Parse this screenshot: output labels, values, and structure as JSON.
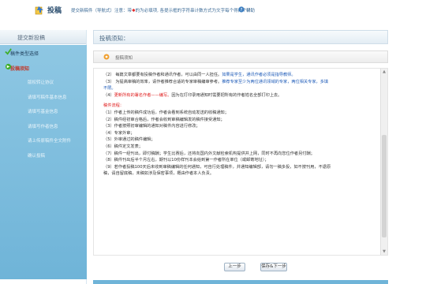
{
  "header": {
    "title": "投稿",
    "subtitle_prefix": "提交新稿件（导航式）注意：带",
    "subtitle_star": "✱",
    "subtitle_suffix": "的为必填项, 各提示框的字符串计数方式为文字每个得两个计",
    "help_label": "帮助"
  },
  "sidebar": {
    "heading": "提交新投稿",
    "items": [
      {
        "label": "稿件类型选择",
        "state": "done"
      },
      {
        "label": "投稿须知",
        "state": "active"
      },
      {
        "label": "版权转让协议",
        "state": "normal"
      },
      {
        "label": "请填写稿件基本信息",
        "state": "normal"
      },
      {
        "label": "请填写基金信息",
        "state": "normal"
      },
      {
        "label": "请填写作者信息",
        "state": "normal"
      },
      {
        "label": "请上传原稿件全文附件",
        "state": "normal"
      },
      {
        "label": "确认投稿",
        "state": "normal"
      }
    ]
  },
  "main": {
    "heading": "投稿须知：",
    "subheading": "投稿须知"
  },
  "notice": {
    "line1a": "（2） 每篇文章都要有投稿作者和通讯作者，可以由同一人担任。",
    "line1b": "如果是学生，通讯作者必须是指导教师。",
    "line2a": "（3） 为提高审稿的效率，请作者推荐合适的专家审稿编审参考。",
    "line2b": "推荐专家至少为两位通讯领域的专家，两位相关专家，多填",
    "line2c": "不限。",
    "line3a": "（4）",
    "line3b": "更新所有的署名作者——编写。",
    "line3c": "因为在打印录用通知时需要把所有的作者姓名全部打印上去。",
    "flow_title": "稿件流程：",
    "flow": [
      "（1）作者上传的稿件成功后，作者会看到系统自动发送的收稿通知；",
      "（2）稿件经初审合格后，作者会收到审稿编辑发的稿件接受通知；",
      "（3）作者按照初审编辑的通知对稿件内容进行修改；",
      "（4）专家外审；",
      "（5）外审通过的稿件编辑；",
      "（6）稿件定文发表；",
      "（7）稿件一经刊出，即付稿酬；学生比赛后，还将向国内外文献检索机构提供并上网，同时不再向您位作者另付酬；",
      "（8）稿件刊出后半个月左右，期刊以10份样刊本会给到第一作者所在单位（或邮寄地址）；",
      "（9）若作者投稿100天后未收到审稿编辑的任何通知，可自行处理稿件，并通知编辑部，请勿一稿多投，如不按刊用，不退原",
      "稿，请自留底稿，未稿如涉及保密事项，概由作者本人负责。"
    ]
  },
  "buttons": {
    "prev_label": "上一步",
    "next_label": "保存&下一步"
  },
  "colors": {
    "menu_bg": "#6fb4d8",
    "accent_blue": "#1e5bb8",
    "alert_red": "#e02020"
  }
}
